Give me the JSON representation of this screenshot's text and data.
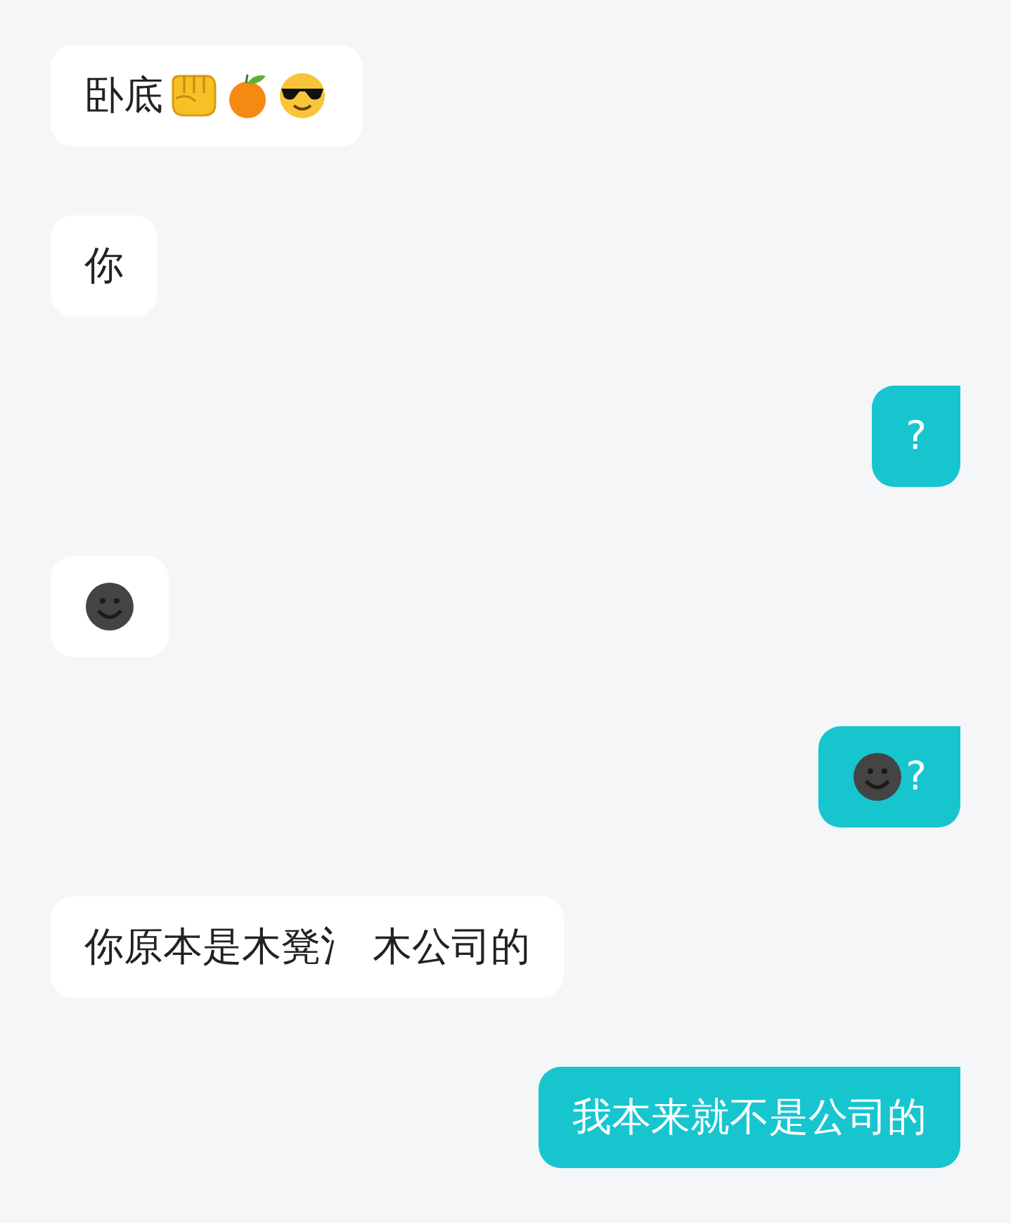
{
  "messages": [
    {
      "outgoing": false,
      "parts": [
        {
          "kind": "text",
          "text": "卧底"
        },
        {
          "kind": "fist"
        },
        {
          "kind": "tangerine"
        },
        {
          "kind": "sunglasses"
        }
      ]
    },
    {
      "outgoing": false,
      "parts": [
        {
          "kind": "text",
          "text": "你"
        }
      ]
    },
    {
      "outgoing": true,
      "parts": [
        {
          "kind": "text",
          "text": "?"
        }
      ]
    },
    {
      "outgoing": false,
      "parts": [
        {
          "kind": "dark_smile"
        }
      ]
    },
    {
      "outgoing": true,
      "parts": [
        {
          "kind": "dark_smile"
        },
        {
          "kind": "text",
          "text": "?"
        }
      ]
    },
    {
      "outgoing": false,
      "parts": [
        {
          "kind": "text",
          "text": "你原本是木凳氵 木公司的"
        }
      ]
    },
    {
      "outgoing": true,
      "parts": [
        {
          "kind": "text",
          "text": "我本来就不是公司的"
        }
      ]
    }
  ]
}
